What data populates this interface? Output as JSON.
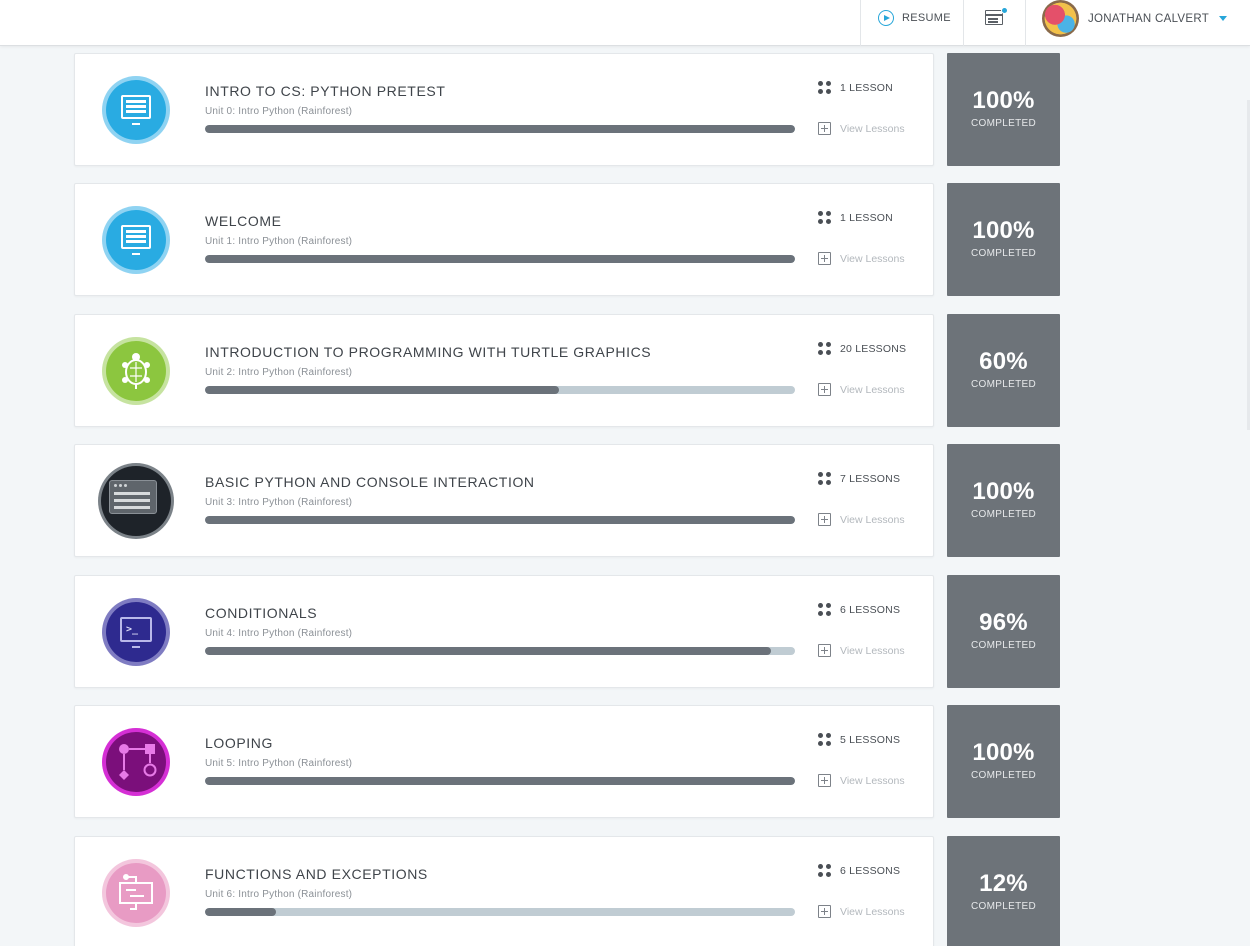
{
  "header": {
    "resume_label": "RESUME",
    "user_name": "JONATHAN CALVERT"
  },
  "colors": {
    "accent": "#27a6d9",
    "progress_fill": "#6b727a",
    "progress_track": "#c0ccd3",
    "completion_box": "#6d7379"
  },
  "units": [
    {
      "title": "INTRO TO CS: PYTHON PRETEST",
      "subtitle": "Unit 0: Intro Python (Rainforest)",
      "lessons": "1 LESSON",
      "view": "View Lessons",
      "percent_label": "100%",
      "completed_label": "COMPLETED",
      "progress": 100,
      "icon": "monitor-icon",
      "icon_color": "#29abe2",
      "ring_color": "#8fd3f2"
    },
    {
      "title": "WELCOME",
      "subtitle": "Unit 1: Intro Python (Rainforest)",
      "lessons": "1 LESSON",
      "view": "View Lessons",
      "percent_label": "100%",
      "completed_label": "COMPLETED",
      "progress": 100,
      "icon": "monitor-icon",
      "icon_color": "#29abe2",
      "ring_color": "#8fd3f2"
    },
    {
      "title": "INTRODUCTION TO PROGRAMMING WITH TURTLE GRAPHICS",
      "subtitle": "Unit 2: Intro Python (Rainforest)",
      "lessons": "20 LESSONS",
      "view": "View Lessons",
      "percent_label": "60%",
      "completed_label": "COMPLETED",
      "progress": 60,
      "icon": "turtle-icon",
      "icon_color": "#8cc63f",
      "ring_color": "#c6e3a0"
    },
    {
      "title": "BASIC PYTHON AND CONSOLE INTERACTION",
      "subtitle": "Unit 3: Intro Python (Rainforest)",
      "lessons": "7 LESSONS",
      "view": "View Lessons",
      "percent_label": "100%",
      "completed_label": "COMPLETED",
      "progress": 100,
      "icon": "console-window-icon",
      "icon_color": "#1e2329",
      "ring_color": "#7b8288"
    },
    {
      "title": "CONDITIONALS",
      "subtitle": "Unit 4: Intro Python (Rainforest)",
      "lessons": "6 LESSONS",
      "view": "View Lessons",
      "percent_label": "96%",
      "completed_label": "COMPLETED",
      "progress": 96,
      "icon": "terminal-prompt-icon",
      "icon_color": "#2e2a8f",
      "ring_color": "#7f7cc2"
    },
    {
      "title": "LOOPING",
      "subtitle": "Unit 5: Intro Python (Rainforest)",
      "lessons": "5 LESSONS",
      "view": "View Lessons",
      "percent_label": "100%",
      "completed_label": "COMPLETED",
      "progress": 100,
      "icon": "flowchart-loop-icon",
      "icon_color": "#7b0f7b",
      "ring_color": "#d52fd5"
    },
    {
      "title": "FUNCTIONS AND EXCEPTIONS",
      "subtitle": "Unit 6: Intro Python (Rainforest)",
      "lessons": "6 LESSONS",
      "view": "View Lessons",
      "percent_label": "12%",
      "completed_label": "COMPLETED",
      "progress": 12,
      "icon": "function-icon",
      "icon_color": "#e89bc4",
      "ring_color": "#f3c6dd"
    }
  ]
}
